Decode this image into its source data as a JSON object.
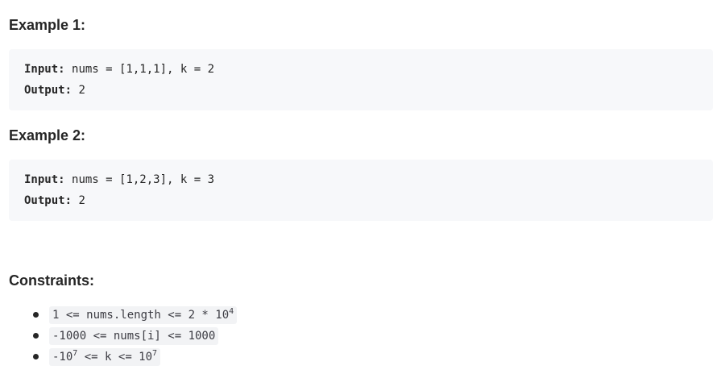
{
  "examples": [
    {
      "title": "Example 1:",
      "input_label": "Input:",
      "input_value": "nums = [1,1,1], k = 2",
      "output_label": "Output:",
      "output_value": "2"
    },
    {
      "title": "Example 2:",
      "input_label": "Input:",
      "input_value": "nums = [1,2,3], k = 3",
      "output_label": "Output:",
      "output_value": "2"
    }
  ],
  "constraints": {
    "title": "Constraints:",
    "items": [
      {
        "base": "1 <= nums.length <= 2 * 10",
        "sup": "4",
        "tail": ""
      },
      {
        "base": "-1000 <= nums[i] <= 1000",
        "sup": "",
        "tail": ""
      },
      {
        "base": "-10",
        "sup": "7",
        "tail": " <= k <= 10",
        "sup2": "7"
      }
    ]
  }
}
